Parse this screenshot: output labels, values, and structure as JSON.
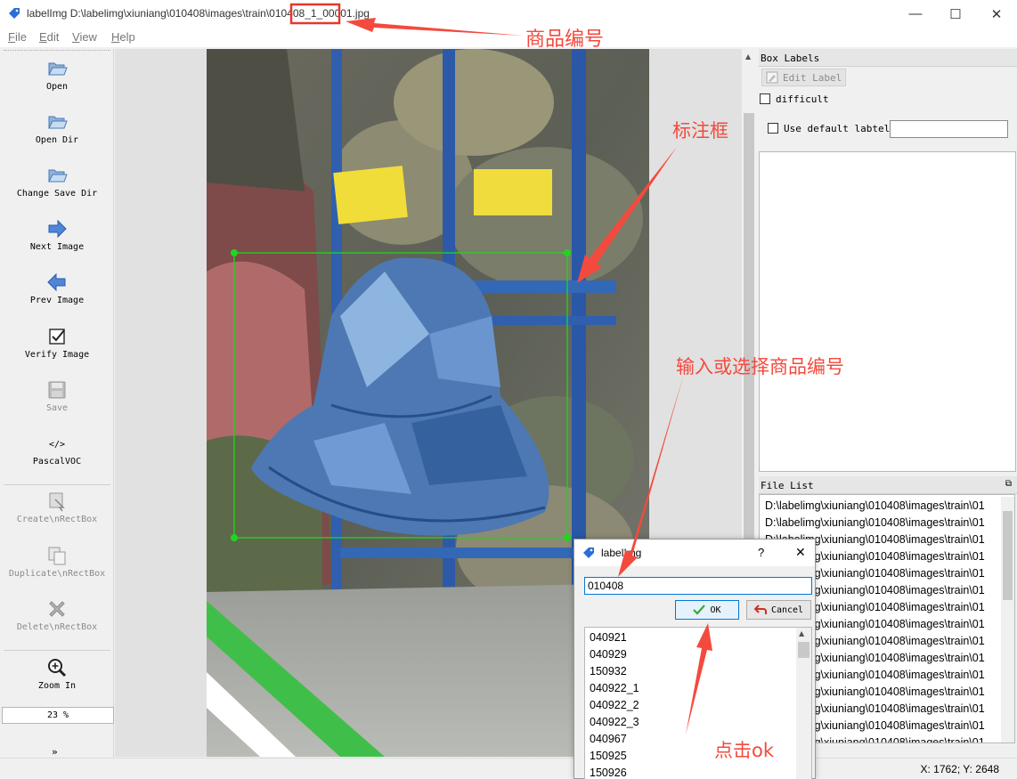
{
  "window": {
    "title": "labelImg D:\\labelimg\\xiuniang\\010408\\images\\train\\010408_1_00001.jpg",
    "minimize_glyph": "—",
    "maximize_glyph": "☐",
    "close_glyph": "✕"
  },
  "menu": [
    {
      "key": "F",
      "rest": "ile"
    },
    {
      "key": "E",
      "rest": "dit"
    },
    {
      "key": "V",
      "rest": "iew"
    },
    {
      "key": "H",
      "rest": "elp"
    }
  ],
  "toolbar": {
    "open": "Open",
    "open_dir": "Open Dir",
    "change_save_dir": "Change Save Dir",
    "next_image": "Next Image",
    "prev_image": "Prev Image",
    "verify_image": "Verify Image",
    "save": "Save",
    "format": "PascalVOC",
    "create_rect": "Create\\nRectBox",
    "duplicate_rect": "Duplicate\\nRectBox",
    "delete_rect": "Delete\\nRectBox",
    "zoom_in": "Zoom In",
    "zoom_value": "23 %",
    "more": "»"
  },
  "box_labels": {
    "title": "Box Labels",
    "edit_label": "Edit Label",
    "difficult": "difficult",
    "use_default": "Use default labtel",
    "default_value": ""
  },
  "file_list": {
    "title": "File List",
    "items": [
      "D:\\labelimg\\xiuniang\\010408\\images\\train\\01",
      "D:\\labelimg\\xiuniang\\010408\\images\\train\\01",
      "D:\\labelimg\\xiuniang\\010408\\images\\train\\01",
      "D:\\labelimg\\xiuniang\\010408\\images\\train\\01",
      "D:\\labelimg\\xiuniang\\010408\\images\\train\\01",
      "D:\\labelimg\\xiuniang\\010408\\images\\train\\01",
      "D:\\labelimg\\xiuniang\\010408\\images\\train\\01",
      "D:\\labelimg\\xiuniang\\010408\\images\\train\\01",
      "D:\\labelimg\\xiuniang\\010408\\images\\train\\01",
      "D:\\labelimg\\xiuniang\\010408\\images\\train\\01",
      "D:\\labelimg\\xiuniang\\010408\\images\\train\\01",
      "D:\\labelimg\\xiuniang\\010408\\images\\train\\01",
      "D:\\labelimg\\xiuniang\\010408\\images\\train\\01",
      "D:\\labelimg\\xiuniang\\010408\\images\\train\\01",
      "D:\\labelimg\\xiuniang\\010408\\images\\train\\01"
    ]
  },
  "status": {
    "coords": "X: 1762; Y: 2648"
  },
  "dialog": {
    "title": "labelImg",
    "help_glyph": "?",
    "close_glyph": "✕",
    "input_value": "010408",
    "ok": "OK",
    "cancel": "Cancel",
    "options": [
      "040921",
      "040929",
      "150932",
      "040922_1",
      "040922_2",
      "040922_3",
      "040967",
      "150925",
      "150926"
    ]
  },
  "annotations": {
    "product_id": "商品编号",
    "bbox": "标注框",
    "input_select": "输入或选择商品编号",
    "click_ok": "点击ok"
  },
  "colors": {
    "annotation": "#f44a3d",
    "bbox": "#22d422",
    "accent": "#0078d7"
  }
}
